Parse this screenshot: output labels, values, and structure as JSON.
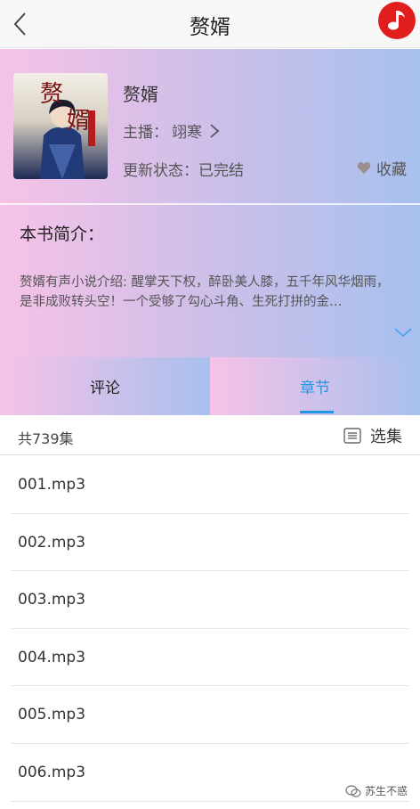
{
  "header": {
    "title": "赘婿",
    "back_icon": "chevron-left-icon",
    "music_icon": "music-note-icon",
    "music_bg": "#e11d1d"
  },
  "book": {
    "title": "赘婿",
    "anchor_label": "主播：",
    "anchor_name": "翊寒",
    "status_label": "更新状态：",
    "status_value": "已完结",
    "favorite_label": "收藏",
    "cover_title_chars": "赘婿"
  },
  "intro": {
    "title": "本书简介：",
    "text": "赘婿有声小说介绍: 醒掌天下权，醉卧美人膝，五千年风华烟雨，是非成败转头空！一个受够了勾心斗角、生死打拼的金…"
  },
  "tabs": [
    {
      "label": "评论",
      "active": false
    },
    {
      "label": "章节",
      "active": true
    }
  ],
  "episodes": {
    "count_text": "共739集",
    "select_label": "选集",
    "items": [
      "001.mp3",
      "002.mp3",
      "003.mp3",
      "004.mp3",
      "005.mp3",
      "006.mp3"
    ]
  },
  "watermark": {
    "text": "苏生不惑"
  },
  "colors": {
    "accent": "#2196e6",
    "gradient_pink": "#f6c2e7",
    "gradient_blue": "#a8c0ee"
  }
}
